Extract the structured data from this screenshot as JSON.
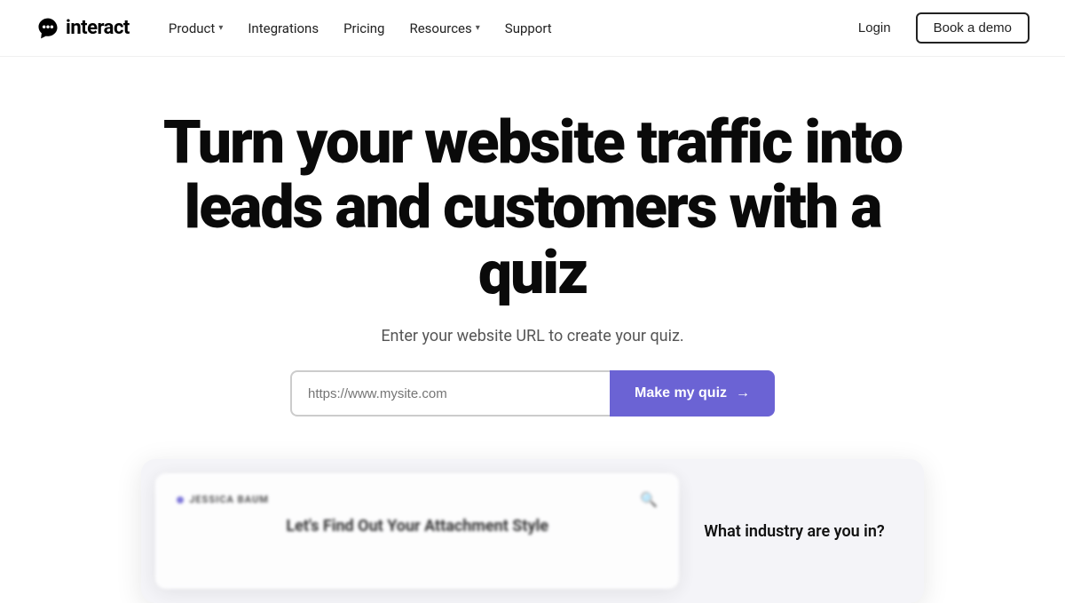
{
  "nav": {
    "logo_text": "interact",
    "links": [
      {
        "label": "Product",
        "has_dropdown": true
      },
      {
        "label": "Integrations",
        "has_dropdown": false
      },
      {
        "label": "Pricing",
        "has_dropdown": false
      },
      {
        "label": "Resources",
        "has_dropdown": true
      },
      {
        "label": "Support",
        "has_dropdown": false
      }
    ],
    "login_label": "Login",
    "demo_label": "Book a demo"
  },
  "hero": {
    "title_line1": "Turn your website traffic into",
    "title_line2": "leads and customers with a quiz",
    "subtitle": "Enter your website URL to create your quiz.",
    "input_placeholder": "https://www.mysite.com",
    "cta_label": "Make my quiz"
  },
  "preview": {
    "card_name": "JESSICA BAUM",
    "card_title": "Let's Find Out Your Attachment Style",
    "side_text": "What industry are you in?"
  }
}
